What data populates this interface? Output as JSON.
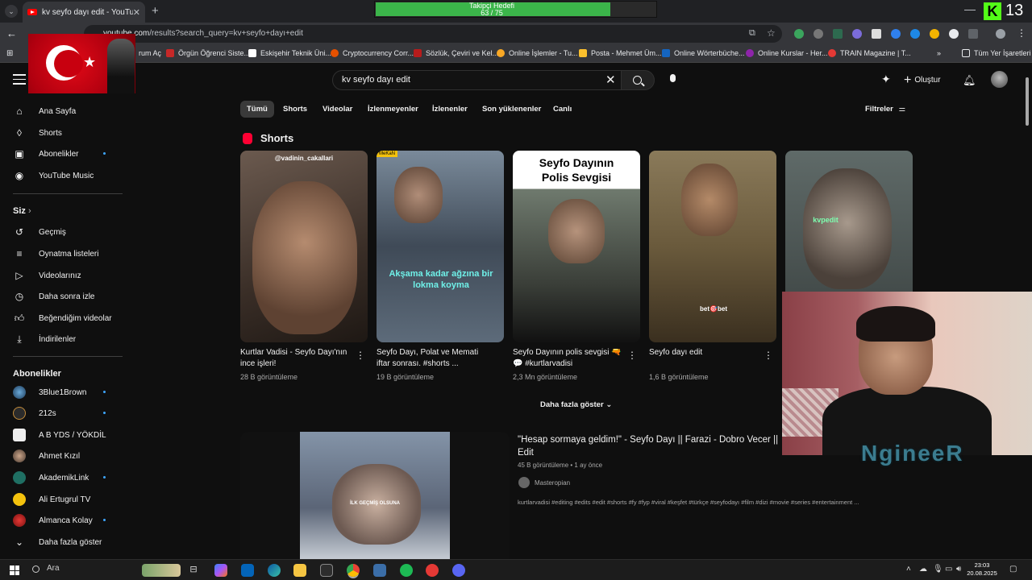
{
  "browser": {
    "tab_title": "kv seyfo dayı edit - YouTube",
    "url_host": "youtube.com",
    "url_path": "/results?search_query=kv+seyfo+dayı+edit",
    "bookmarks": [
      "rum Aç",
      "Örgün Öğrenci Siste...",
      "Eskişehir Teknik Üni...",
      "Cryptocurrency Corr...",
      "Sözlük, Çeviri ve Kel...",
      "Online İşlemler - Tu...",
      "Posta - Mehmet Üm...",
      "Online Wörterbüche...",
      "Online Kurslar - Her...",
      "TRAIN Magazine | T..."
    ],
    "all_bookmarks": "Tüm Yer İşaretleri"
  },
  "overlay": {
    "goal_title": "Takipçi Hedefi",
    "goal_progress": "63 / 75",
    "goal_fraction": 0.84,
    "kick_count": "13",
    "streamer_name": "NgineeR"
  },
  "youtube": {
    "search_query": "kv seyfo dayı edit",
    "create_label": "Oluştur",
    "sidebar": {
      "main": [
        "Ana Sayfa",
        "Shorts",
        "Abonelikler",
        "YouTube Music"
      ],
      "you_heading": "Siz",
      "you": [
        "Geçmiş",
        "Oynatma listeleri",
        "Videolarınız",
        "Daha sonra izle",
        "Beğendiğim videolar",
        "İndirilenler"
      ],
      "subs_heading": "Abonelikler",
      "subs": [
        "3Blue1Brown",
        "212s",
        "A B YDS / YÖKDİL",
        "Ahmet Kızıl",
        "AkademikLink",
        "Ali Ertugrul TV",
        "Almanca Kolay"
      ],
      "show_more": "Daha fazla göster"
    },
    "chips": [
      "Tümü",
      "Shorts",
      "Videolar",
      "İzlenmeyenler",
      "İzlenenler",
      "Son yüklenenler",
      "Canlı"
    ],
    "filters_label": "Filtreler",
    "shorts_heading": "Shorts",
    "shorts": [
      {
        "title": "Kurtlar Vadisi - Seyfo Dayı'nın ince işleri!",
        "views": "28 B görüntüleme",
        "overlay": "@vadinin_cakallari"
      },
      {
        "title": "Seyfo Dayı, Polat ve Memati iftar sonrası. #shorts ...",
        "views": "19 B görüntüleme",
        "overlay": "Akşama kadar ağzına bir lokma koyma"
      },
      {
        "title": "Seyfo Dayının polis sevgisi 🔫💬 #kurtlarvadisi",
        "views": "2,3 Mn görüntüleme",
        "overlay": "Seyfo Dayının Polis Sevgisi"
      },
      {
        "title": "Seyfo dayı edit",
        "views": "1,6 B görüntüleme",
        "overlay": "bet🎯bet"
      },
      {
        "title": "",
        "views": "",
        "overlay": "kvpedit"
      }
    ],
    "shorts_more": "Daha fazla göster",
    "video": {
      "title": "\"Hesap sormaya geldim!\" - Seyfo Dayı || Farazi - Dobro Vecer || Edit",
      "meta": "45 B görüntüleme • 1 ay önce",
      "channel": "Masteropian",
      "description": "kurtlarvadisi #editing #edits #edit #shorts #fy #fyp #viral #keşfet #türkçe #seyfodayı #film #dizi #movie #series #entertainment ...",
      "thumb_caption": "İLK GEÇMİŞ OLSUNA"
    }
  },
  "taskbar": {
    "search_label": "Ara",
    "time": "23:03",
    "date": "20.08.2025"
  }
}
